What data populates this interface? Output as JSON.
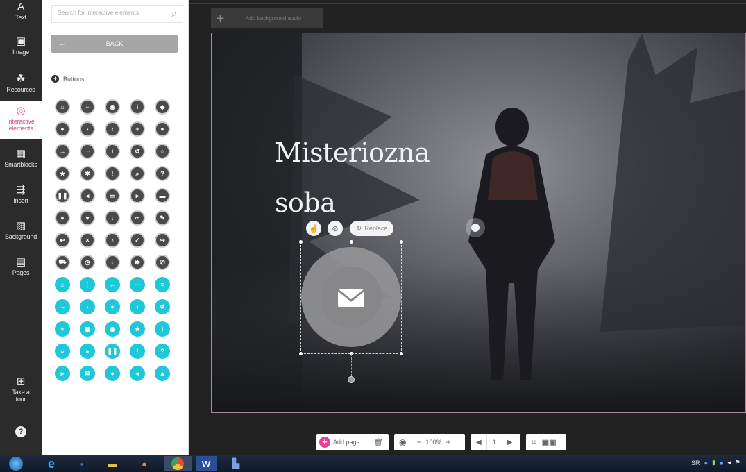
{
  "rail": {
    "items": [
      {
        "label": "Text",
        "icon": "A"
      },
      {
        "label": "Image",
        "icon": "▣"
      },
      {
        "label": "Resources",
        "icon": "☘"
      },
      {
        "label": "Interactive elements",
        "icon": "◎"
      },
      {
        "label": "Smartblocks",
        "icon": "▦"
      },
      {
        "label": "Insert",
        "icon": "⇶"
      },
      {
        "label": "Background",
        "icon": "▨"
      },
      {
        "label": "Pages",
        "icon": "▤"
      },
      {
        "label": "Take a tour",
        "icon": "⊞"
      },
      {
        "label": "",
        "icon": "?"
      }
    ]
  },
  "panel": {
    "search_placeholder": "Search for interactive elements",
    "back_label": "BACK",
    "section_label": "Buttons"
  },
  "editor": {
    "audio_label": "Add background audio",
    "title_line1": "Misteriozna",
    "title_line2": "soba",
    "replace_label": "Replace",
    "accent_color": "#1ec8d8"
  },
  "bottom": {
    "add_page_label": "Add page",
    "zoom": "100%",
    "page_number": "1"
  },
  "taskbar": {
    "tray_lang": "SR"
  }
}
